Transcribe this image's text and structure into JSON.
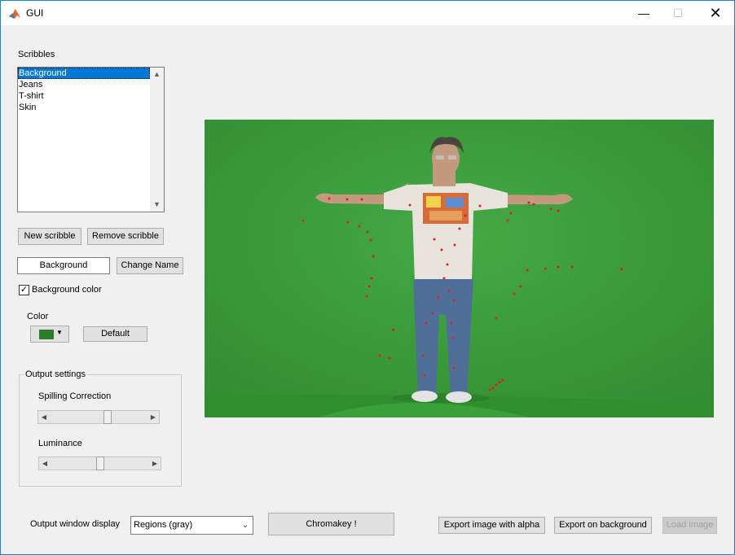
{
  "window": {
    "title": "GUI",
    "min": "—",
    "max": "☐",
    "close": "✕"
  },
  "scribbles": {
    "label": "Scribbles",
    "items": [
      "Background",
      "Jeans",
      "T-shirt",
      "Skin"
    ],
    "selected_index": 0,
    "new_button": "New scribble",
    "remove_button": "Remove scribble",
    "name_value": "Background",
    "change_name_button": "Change Name",
    "background_color_checkbox": {
      "label": "Background color",
      "checked": true
    }
  },
  "color": {
    "label": "Color",
    "swatch": "#2d7d2d",
    "default_button": "Default"
  },
  "output_settings": {
    "title": "Output settings",
    "spilling_label": "Spilling Correction",
    "spilling_value": 0.6,
    "luminance_label": "Luminance",
    "luminance_value": 0.5
  },
  "bottom": {
    "output_label": "Output window display",
    "output_value": "Regions (gray)",
    "chromakey_button": "Chromakey !",
    "export_alpha_button": "Export image with alpha",
    "export_background_button": "Export on background",
    "load_image_button": "Load image"
  },
  "colors": {
    "accent": "#0078d7",
    "green_screen": "#3f9e3f",
    "scribble_marks": "#e02020"
  }
}
